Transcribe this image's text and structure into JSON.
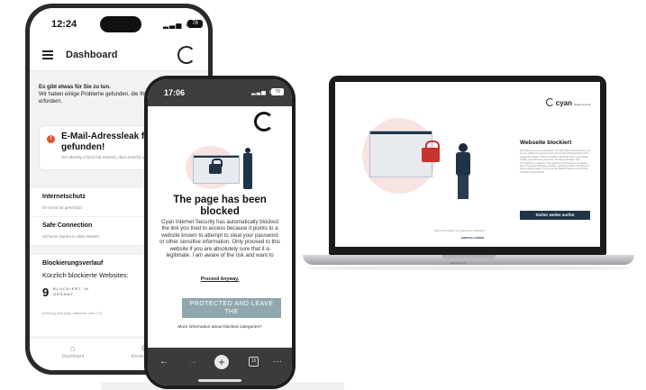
{
  "back_phone": {
    "time": "12:24",
    "battery": "78",
    "header_title": "Dashboard",
    "alert_bold": "Es gibt etwas für Sie zu tun.",
    "alert_text": "Wir haben einige Probleme gefunden, die Ihre Aufmerksamkeit erfordern.",
    "card_title": "E-Mail-Adressleak für test gefunden!",
    "card_sub": "Der Identity Check hat erkannt, dass test@d wurde",
    "rows": [
      {
        "title": "Internetschutz",
        "sub": "Ihr Gerät ist geschützt"
      },
      {
        "title": "Safe Connection",
        "sub": "Sicheres Surfen in allen Netzen"
      }
    ],
    "block_title": "Blockierungsverlauf",
    "block_sub": "Kürzlich blockierte Websites:",
    "count": "9",
    "count_label": "BLOCKIERT IN GESAMT",
    "url": "phishing-test.cyan-networks.com (7x)",
    "nav": [
      {
        "label": "Dashboard",
        "icon": "home-icon"
      },
      {
        "label": "Einstellungen",
        "icon": "gear-icon"
      }
    ]
  },
  "front_phone": {
    "time": "17:06",
    "battery": "79",
    "title": "The page has been blocked",
    "body": "Cyan Internet Security has automatically blocked the link you tried to access because it points to a website known to attempt to steal your password or other sensitive information. Only proceed to this website if you are absolutely sure that it is legitimate. I am aware of the risk and want to",
    "proceed": "Proceed Anyway.",
    "button": "PROTECTED AND LEAVE THE",
    "more": "More information about blocked categories?",
    "tabs_count": "16"
  },
  "laptop": {
    "logo": "cyan",
    "logo_sub": "digital security",
    "title": "Webseite blockiert",
    "text": "Die Webseite wurde automatisch von cyan Web Guard blockiert, da sie als gefährlich eingestuft wird und aus Sicherheitsgründen nicht aufgerufen werden sollte. Auf solchen Websites finden sich häufig Inhalte sowie Phishing-Versuche, die darauf abzielen, Ihre Privatsphäre zu verletzen oder geheime Informationen zu stehlen. Wenn Sie dieser Webseite trotzdem vertrauen, klicken Sie bitte auf Seite trotzdem laden. Ich bin mir des Risikos bewusst und möchte trotzdem weitermachen.",
    "button": "Sicher weiter surfen",
    "more": "Mehr Information zur gelöschten Website?",
    "settings": "EINSTELLUNGEN",
    "brand": "MacBook Pro"
  },
  "colors": {
    "accent": "#1f3448",
    "danger": "#c8322f",
    "button_grey": "#8fa7ad"
  }
}
